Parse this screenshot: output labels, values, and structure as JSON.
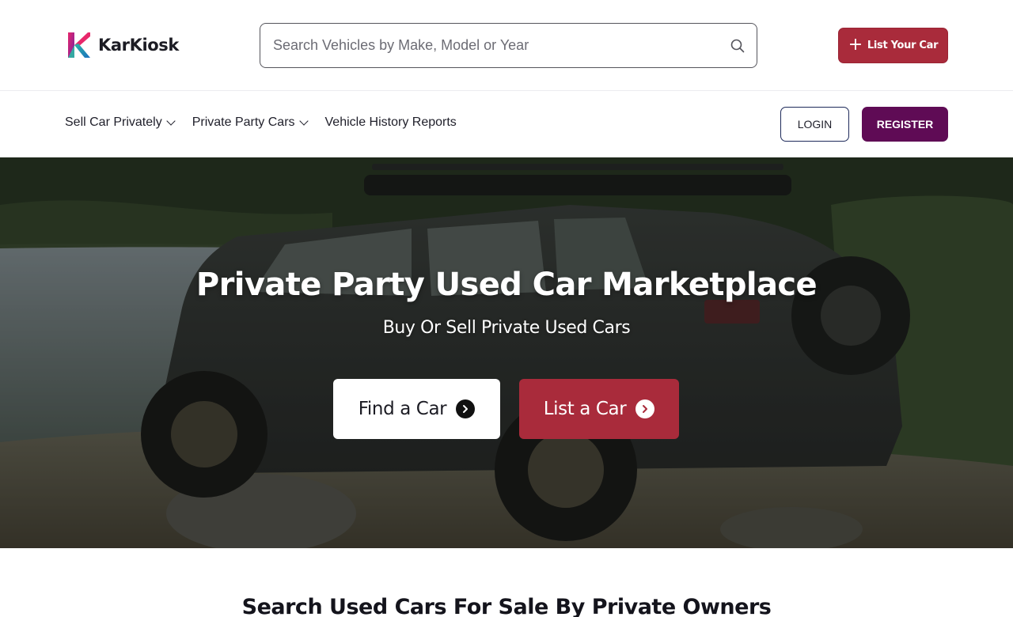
{
  "brand": {
    "name": "KarKiosk",
    "logo_icon": "k-logo-icon"
  },
  "search": {
    "placeholder": "Search Vehicles by Make, Model or Year",
    "value": "",
    "icon": "search-icon"
  },
  "header": {
    "list_your_car_label": "List Your Car",
    "list_icon": "plus-icon"
  },
  "nav": {
    "items": [
      {
        "label": "Sell Car Privately",
        "has_dropdown": true
      },
      {
        "label": "Private Party Cars",
        "has_dropdown": true
      },
      {
        "label": "Vehicle History Reports",
        "has_dropdown": false
      }
    ],
    "login_label": "LOGIN",
    "register_label": "REGISTER"
  },
  "hero": {
    "title": "Private Party Used Car Marketplace",
    "subtitle": "Buy Or Sell Private Used Cars",
    "find_label": "Find a Car",
    "list_label": "List a Car",
    "arrow_icon": "arrow-right-circle-icon"
  },
  "section": {
    "title": "Search Used Cars For Sale By Private Owners"
  },
  "colors": {
    "accent_red": "#a92b3b",
    "register_purple": "#5f0b55",
    "login_border": "#1e2a5a",
    "text_dark": "#1f1f2a"
  }
}
